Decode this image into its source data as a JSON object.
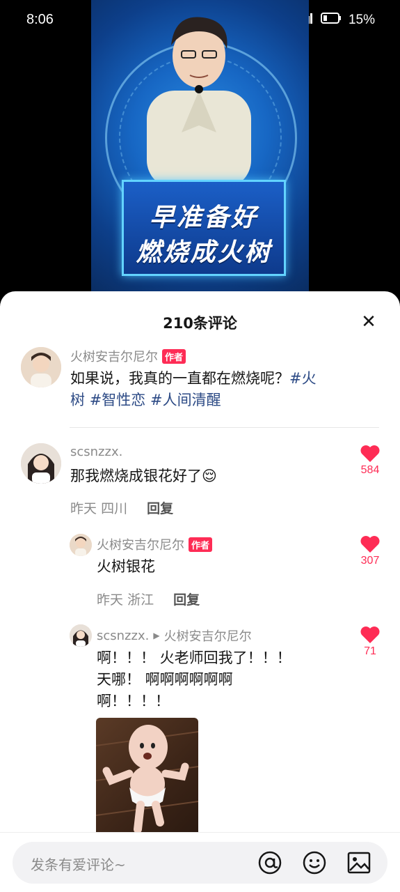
{
  "status_bar": {
    "time": "8:06",
    "battery": "15%"
  },
  "video": {
    "caption_line1": "早准备好",
    "caption_line2": "燃烧成火树"
  },
  "comments_panel": {
    "title": "210条评论",
    "author_post": {
      "username": "火树安吉尔尼尔",
      "badge": "作者",
      "text_plain": "如果说，我真的一直都在燃烧呢？",
      "tag1": "#火",
      "tag1b": "树",
      "tag2": "#智性恋",
      "tag3": "#人间清醒"
    },
    "comments": [
      {
        "username": "scsnzzx.",
        "text": "那我燃烧成银花好了😌",
        "date": "昨天",
        "location": "四川",
        "reply_label": "回复",
        "likes": "584"
      }
    ],
    "replies": [
      {
        "username": "火树安吉尔尼尔",
        "badge": "作者",
        "text": "火树银花",
        "date": "昨天",
        "location": "浙江",
        "reply_label": "回复",
        "likes": "307"
      },
      {
        "username": "scsnzzx.",
        "reply_to": "火树安吉尔尼尔",
        "text_line1": "啊！！！ 火老师回我了！！！",
        "text_line2": "天哪！ 啊啊啊啊啊啊",
        "text_line3": "啊！！！！",
        "likes": "71"
      }
    ]
  },
  "input": {
    "placeholder": "发条有爱评论~"
  },
  "colors": {
    "accent": "#fe2c55",
    "tag": "#2c4a85",
    "meta": "#8a8a8a"
  }
}
